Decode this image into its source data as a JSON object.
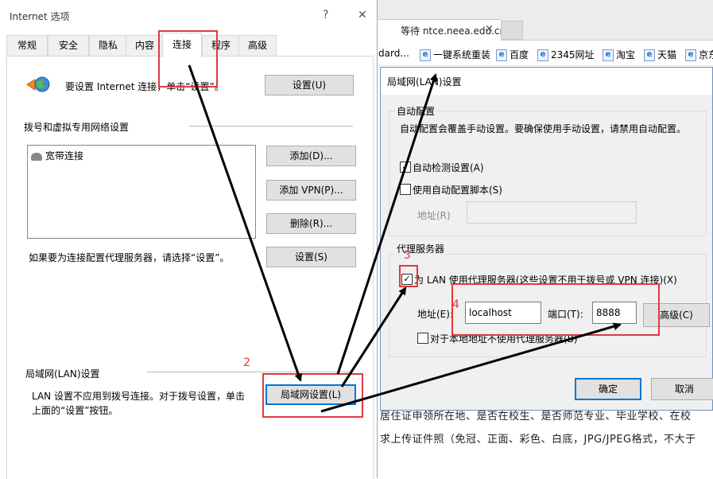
{
  "browser": {
    "tab_title": "等待 ntce.neea.edu.cn",
    "tab_close": "×",
    "favorites": [
      "dard...",
      "一键系统重装",
      "百度",
      "2345网址",
      "淘宝",
      "天猫",
      "京东"
    ],
    "page_line1": "居住证申领所在地、是否在校生、是否师范专业、毕业学校、在校",
    "page_line2": "求上传证件照（免冠、正面、彩色、白底，JPG/JPEG格式，不大于"
  },
  "internet_options": {
    "title": "Internet 选项",
    "help_btn": "?",
    "close_btn": "✕",
    "tabs": [
      "常规",
      "安全",
      "隐私",
      "内容",
      "连接",
      "程序",
      "高级"
    ],
    "setup_text": "要设置 Internet 连接，单击“设置”。",
    "setup_button": "设置(U)",
    "dialup_group": "拨号和虚拟专用网络设置",
    "connections": [
      "宽带连接"
    ],
    "add_button": "添加(D)...",
    "add_vpn_button": "添加 VPN(P)...",
    "remove_button": "删除(R)...",
    "proxy_hint": "如果要为连接配置代理服务器，请选择“设置”。",
    "settings_button": "设置(S)",
    "lan_group": "局域网(LAN)设置",
    "lan_text_line1": "LAN 设置不应用到拨号连接。对于拨号设置，单击",
    "lan_text_line2": "上面的“设置”按钮。",
    "lan_button": "局域网设置(L)"
  },
  "lan_dialog": {
    "title": "局域网(LAN)设置",
    "auto_config_group": "自动配置",
    "auto_config_text": "自动配置会覆盖手动设置。要确保使用手动设置，请禁用自动配置。",
    "auto_detect_label": "自动检测设置(A)",
    "auto_detect_checked": true,
    "use_script_label": "使用自动配置脚本(S)",
    "use_script_checked": false,
    "address_label": "地址(R)",
    "proxy_group": "代理服务器",
    "use_proxy_label": "为 LAN 使用代理服务器(这些设置不用于拨号或 VPN 连接)(X)",
    "use_proxy_checked": true,
    "proxy_address_label": "地址(E):",
    "proxy_address_value": "localhost",
    "port_label": "端口(T):",
    "port_value": "8888",
    "advanced_button": "高级(C)",
    "bypass_local_label": "对于本地地址不使用代理服务器(B)",
    "bypass_local_checked": false,
    "ok_button": "确定",
    "cancel_button": "取消"
  },
  "annotations": {
    "step2": "2",
    "step3": "3",
    "step4": "4",
    "color": "#e0393e"
  }
}
